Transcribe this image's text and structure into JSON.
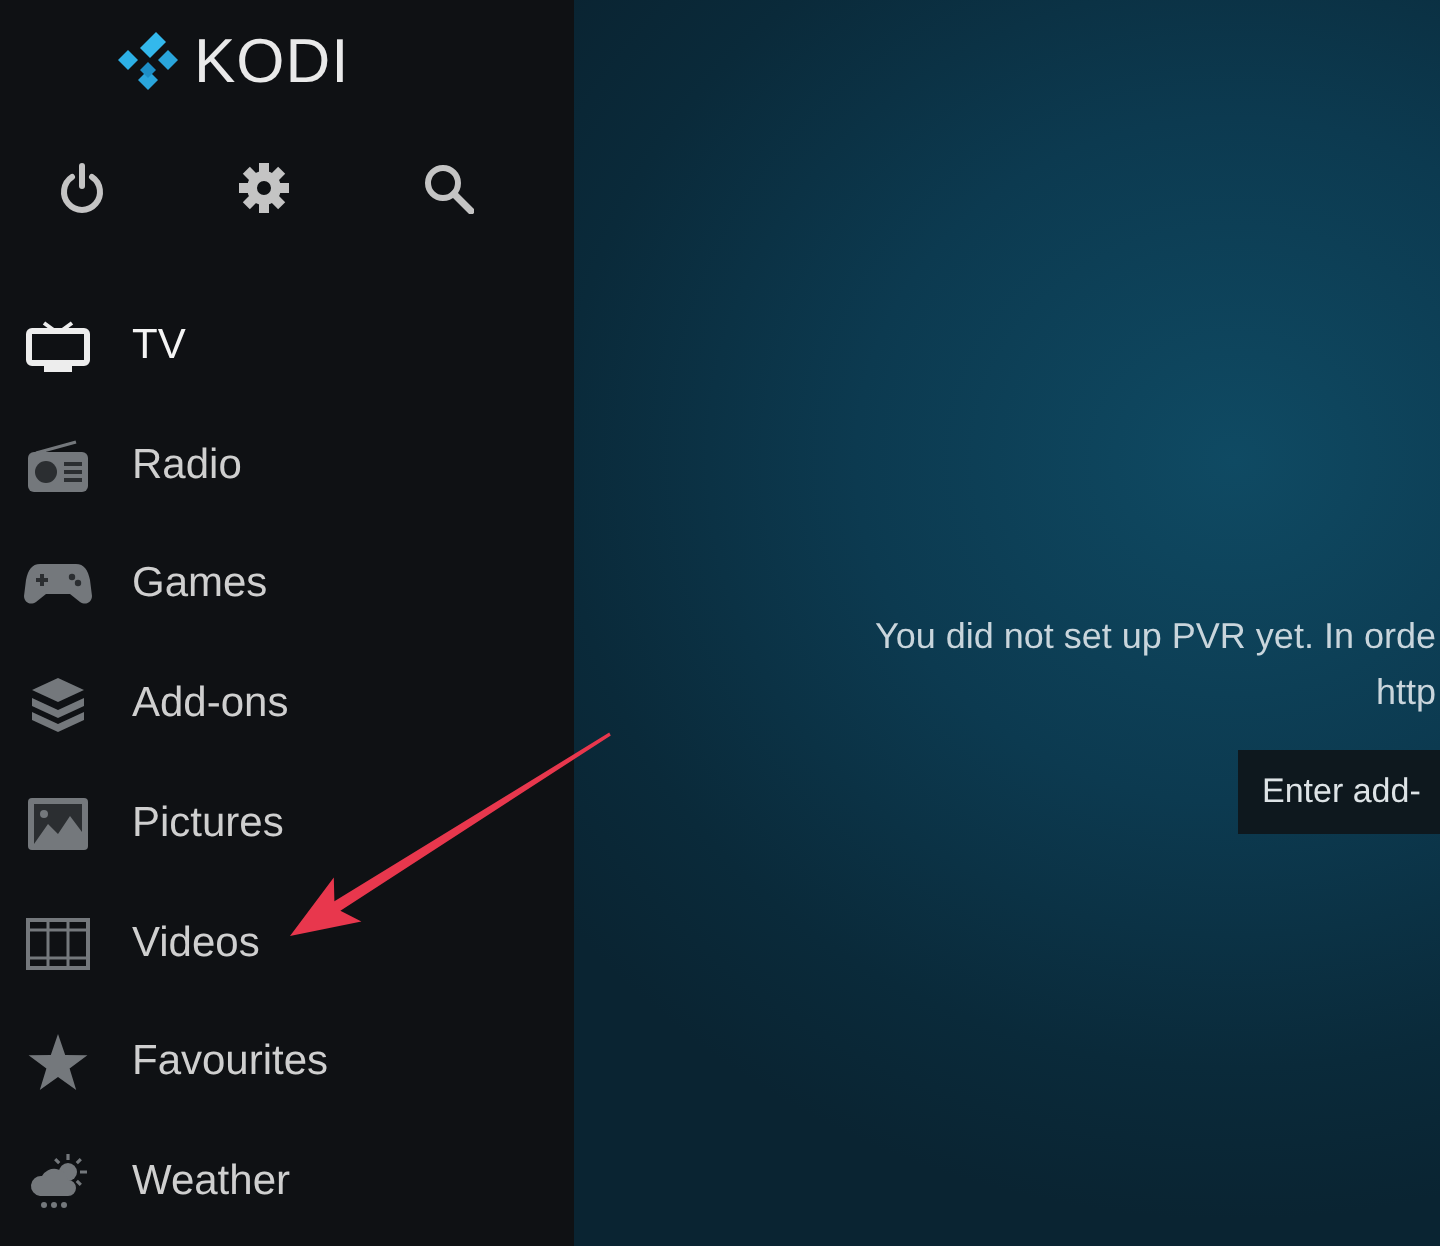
{
  "logo": {
    "text": "KODI"
  },
  "menu": [
    {
      "label": "TV",
      "selected": true
    },
    {
      "label": "Radio",
      "selected": false
    },
    {
      "label": "Games",
      "selected": false
    },
    {
      "label": "Add-ons",
      "selected": false
    },
    {
      "label": "Pictures",
      "selected": false
    },
    {
      "label": "Videos",
      "selected": false
    },
    {
      "label": "Favourites",
      "selected": false
    },
    {
      "label": "Weather",
      "selected": false
    }
  ],
  "pvr_message": {
    "lines": [
      "You did not set up PVR yet. In orde",
      "http"
    ],
    "button": "Enter add-"
  },
  "annotations": [
    {
      "kind": "arrow"
    }
  ]
}
